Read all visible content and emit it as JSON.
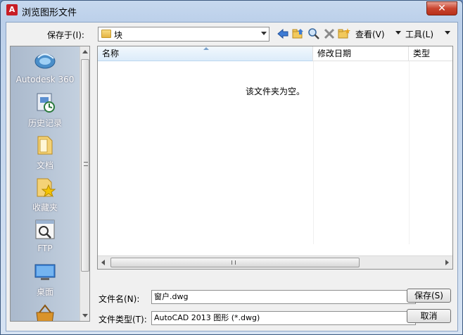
{
  "window": {
    "title": "浏览图形文件",
    "logo_letter": "A",
    "close_glyph": "✕"
  },
  "toolbar": {
    "save_in_label": "保存于(I):",
    "save_in_value": "块",
    "back_icon": "back-arrow-icon",
    "up_icon": "up-folder-icon",
    "search_icon": "search-web-icon",
    "delete_icon": "delete-icon",
    "new_folder_icon": "new-folder-icon",
    "view_label": "查看(V)",
    "tools_label": "工具(L)"
  },
  "places": [
    {
      "label": "Autodesk 360",
      "icon": "autodesk-360-icon"
    },
    {
      "label": "历史记录",
      "icon": "history-icon"
    },
    {
      "label": "文档",
      "icon": "documents-icon"
    },
    {
      "label": "收藏夹",
      "icon": "favorites-icon"
    },
    {
      "label": "FTP",
      "icon": "ftp-icon"
    },
    {
      "label": "桌面",
      "icon": "desktop-icon"
    }
  ],
  "file_list": {
    "columns": [
      "名称",
      "修改日期",
      "类型"
    ],
    "empty_message": "该文件夹为空。"
  },
  "file_name": {
    "label": "文件名(N):",
    "value": "窗户.dwg"
  },
  "file_type": {
    "label": "文件类型(T):",
    "value": "AutoCAD 2013 图形 (*.dwg)"
  },
  "buttons": {
    "save": "保存(S)",
    "cancel": "取消"
  },
  "colors": {
    "autocad_red": "#c81d25",
    "close_red": "#c9452f",
    "title_blue": "#c6d8ee"
  }
}
